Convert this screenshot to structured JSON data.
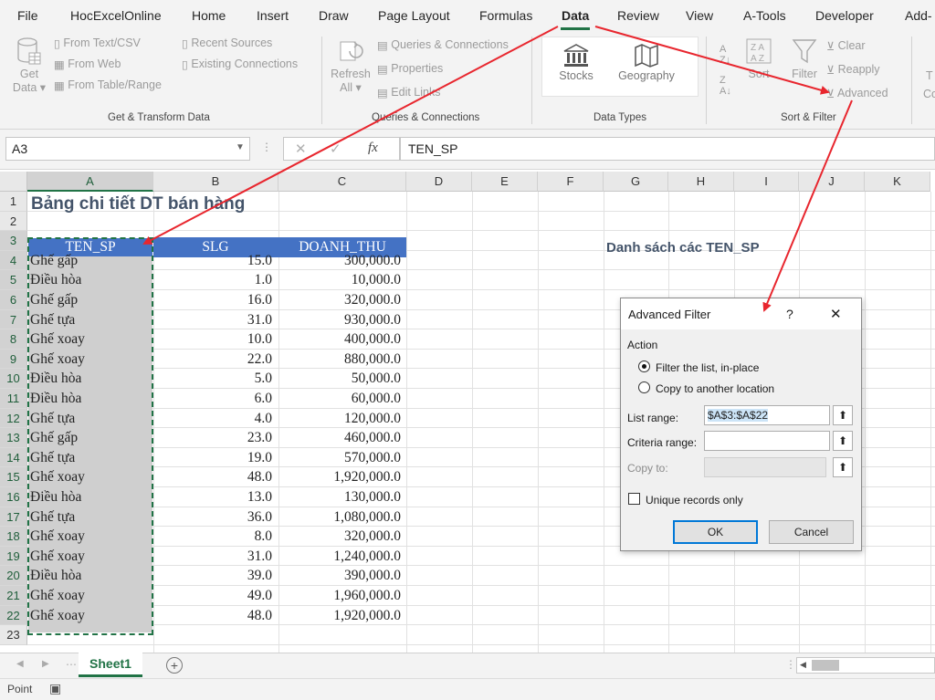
{
  "menu": [
    "File",
    "HocExcelOnline",
    "Home",
    "Insert",
    "Draw",
    "Page Layout",
    "Formulas",
    "Data",
    "Review",
    "View",
    "A-Tools",
    "Developer",
    "Add-"
  ],
  "ribbon": {
    "get_data": [
      "Get",
      "Data ▾"
    ],
    "from_text_csv": "From Text/CSV",
    "from_web": "From Web",
    "from_table_range": "From Table/Range",
    "recent_sources": "Recent Sources",
    "existing_connections": "Existing Connections",
    "group_get_transform": "Get & Transform Data",
    "refresh_all": [
      "Refresh",
      "All ▾"
    ],
    "queries_connections": "Queries & Connections",
    "properties": "Properties",
    "edit_links": "Edit Links",
    "group_queries": "Queries & Connections",
    "stocks": "Stocks",
    "geography": "Geography",
    "group_data_types": "Data Types",
    "sort": "Sort",
    "filter": "Filter",
    "clear": "Clear",
    "reapply": "Reapply",
    "advanced": "Advanced",
    "group_sort_filter": "Sort & Filter",
    "partial_right": [
      "T",
      "Co"
    ]
  },
  "formula_bar": {
    "name_box": "A3",
    "formula": "TEN_SP",
    "fx": "fx"
  },
  "columns": [
    "A",
    "B",
    "C",
    "D",
    "E",
    "F",
    "G",
    "H",
    "I",
    "J",
    "K"
  ],
  "rows": [
    "1",
    "2",
    "3",
    "4",
    "5",
    "6",
    "7",
    "8",
    "9",
    "10",
    "11",
    "12",
    "13",
    "14",
    "15",
    "16",
    "17",
    "18",
    "19",
    "20",
    "21",
    "22",
    "23"
  ],
  "sheet": {
    "title": "Bảng chi tiết DT bán hàng",
    "headers": [
      "TEN_SP",
      "SLG",
      "DOANH_THU"
    ],
    "data": [
      [
        "Ghế gấp",
        "15.0",
        "300,000.0"
      ],
      [
        "Điều hòa",
        "1.0",
        "10,000.0"
      ],
      [
        "Ghế gấp",
        "16.0",
        "320,000.0"
      ],
      [
        "Ghế tựa",
        "31.0",
        "930,000.0"
      ],
      [
        "Ghế xoay",
        "10.0",
        "400,000.0"
      ],
      [
        "Ghế xoay",
        "22.0",
        "880,000.0"
      ],
      [
        "Điều hòa",
        "5.0",
        "50,000.0"
      ],
      [
        "Điều hòa",
        "6.0",
        "60,000.0"
      ],
      [
        "Ghế tựa",
        "4.0",
        "120,000.0"
      ],
      [
        "Ghế gấp",
        "23.0",
        "460,000.0"
      ],
      [
        "Ghế tựa",
        "19.0",
        "570,000.0"
      ],
      [
        "Ghế xoay",
        "48.0",
        "1,920,000.0"
      ],
      [
        "Điều hòa",
        "13.0",
        "130,000.0"
      ],
      [
        "Ghế tựa",
        "36.0",
        "1,080,000.0"
      ],
      [
        "Ghế xoay",
        "8.0",
        "320,000.0"
      ],
      [
        "Ghế xoay",
        "31.0",
        "1,240,000.0"
      ],
      [
        "Điều hòa",
        "39.0",
        "390,000.0"
      ],
      [
        "Ghế xoay",
        "49.0",
        "1,960,000.0"
      ],
      [
        "Ghế xoay",
        "48.0",
        "1,920,000.0"
      ]
    ],
    "list_title": "Danh sách các TEN_SP"
  },
  "dialog": {
    "title": "Advanced Filter",
    "help": "?",
    "close": "✕",
    "action_label": "Action",
    "opt_inplace": "Filter the list, in-place",
    "opt_copy": "Copy to another location",
    "list_range_label": "List range:",
    "list_range_value": "$A$3:$A$22",
    "criteria_label": "Criteria range:",
    "criteria_value": "",
    "copy_to_label": "Copy to:",
    "unique_label": "Unique records only",
    "ok": "OK",
    "cancel": "Cancel"
  },
  "tabs": {
    "sheet1": "Sheet1",
    "add": "+"
  },
  "status": {
    "mode": "Point"
  },
  "colors": {
    "accent": "#217346",
    "header_blue": "#4472c4",
    "title_text": "#44546a",
    "arrow_red": "#e8262e"
  }
}
